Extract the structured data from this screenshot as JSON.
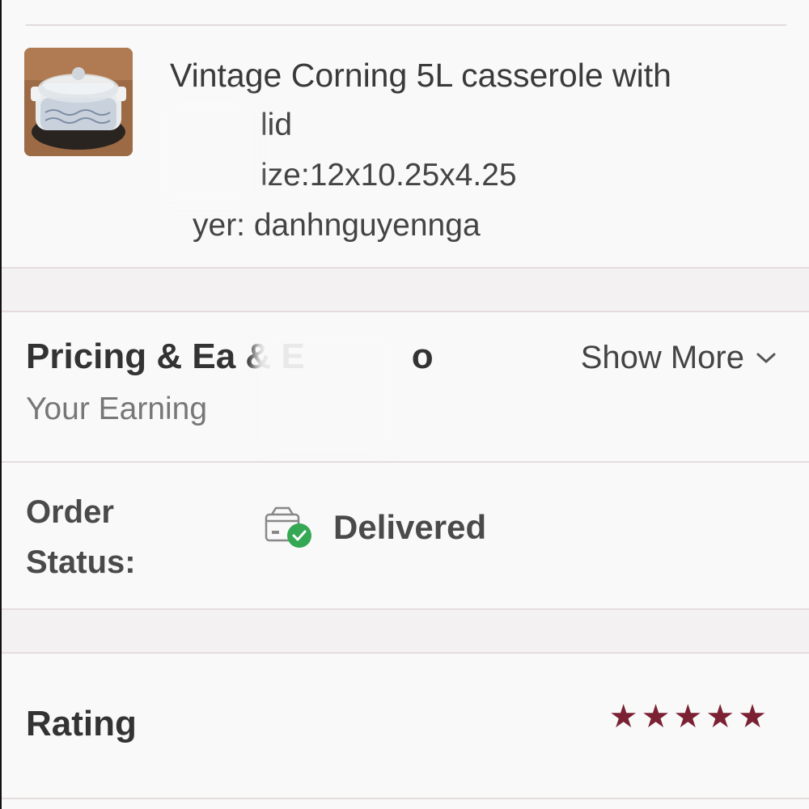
{
  "item": {
    "title": "Vintage Corning 5L casserole with",
    "title_cont": "lid",
    "size": "ize:12x10.25x4.25",
    "buyer": "yer: danhnguyennga"
  },
  "pricing": {
    "title": "Pricing & Ea & E",
    "title_end": "o",
    "subtitle": "Your Earning",
    "show_more_label": "Show More",
    "show_more_icon": "chevron-down-icon"
  },
  "order": {
    "label_line1": "Order",
    "label_line2": "Status:",
    "status": "Delivered",
    "status_icon": "package-delivered-icon",
    "status_color": "#34a853"
  },
  "rating": {
    "label": "Rating",
    "stars": 5,
    "max_stars": 5,
    "star_color": "#7a2233"
  }
}
